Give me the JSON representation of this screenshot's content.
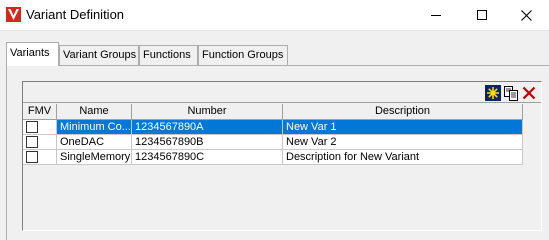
{
  "window": {
    "title": "Variant Definition",
    "icons": {
      "app": "v-logo-icon",
      "minimize": "minimize-icon",
      "maximize": "maximize-icon",
      "close": "close-icon"
    }
  },
  "tabs": [
    {
      "label": "Variants",
      "active": true
    },
    {
      "label": "Variant Groups",
      "active": false
    },
    {
      "label": "Functions",
      "active": false
    },
    {
      "label": "Function Groups",
      "active": false
    }
  ],
  "toolbar": {
    "icons": [
      "new-icon",
      "copy-icon",
      "delete-icon"
    ]
  },
  "table": {
    "columns": [
      "FMV",
      "Name",
      "Number",
      "Description"
    ],
    "rows": [
      {
        "fmv": false,
        "name": "Minimum Co...",
        "number": "1234567890A",
        "description": "New Var 1",
        "selected": true
      },
      {
        "fmv": false,
        "name": "OneDAC",
        "number": "1234567890B",
        "description": "New Var 2",
        "selected": false
      },
      {
        "fmv": false,
        "name": "SingleMemory",
        "number": "1234567890C",
        "description": "Description for New Variant",
        "selected": false
      }
    ]
  },
  "colors": {
    "selection": "#0078d7",
    "app_icon": "#d9261c",
    "delete_icon": "#c00000",
    "new_icon_bg": "#0a246a"
  }
}
